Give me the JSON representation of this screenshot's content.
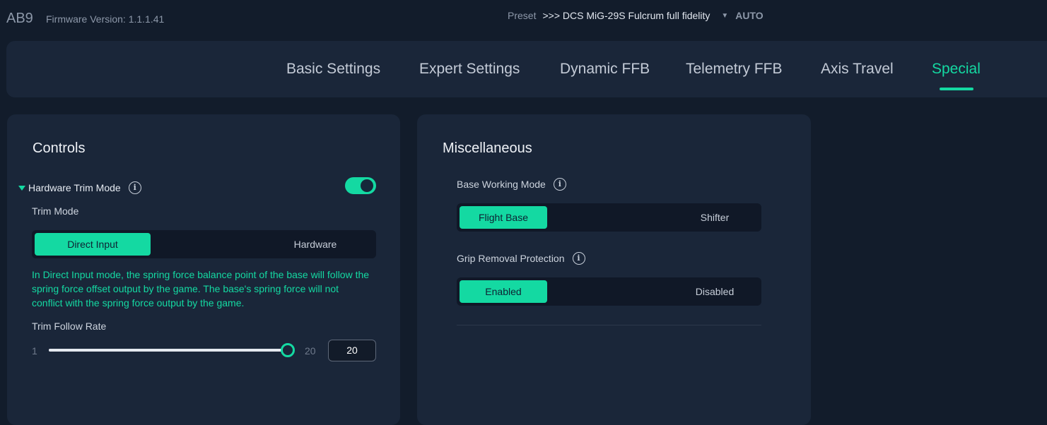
{
  "header": {
    "app_name": "AB9",
    "firmware": "Firmware Version: 1.1.1.41",
    "preset_label": "Preset",
    "preset_value": ">>> DCS MiG-29S Fulcrum  full fidelity",
    "preset_mode": "AUTO"
  },
  "tabs": [
    {
      "label": "Basic Settings"
    },
    {
      "label": "Expert Settings"
    },
    {
      "label": "Dynamic FFB"
    },
    {
      "label": "Telemetry FFB"
    },
    {
      "label": "Axis Travel"
    },
    {
      "label": "Special",
      "active": true
    }
  ],
  "controls": {
    "title": "Controls",
    "hardware_trim_mode": {
      "label": "Hardware Trim Mode",
      "enabled": true
    },
    "trim_mode": {
      "label": "Trim Mode",
      "options": [
        "Direct Input",
        "Hardware"
      ],
      "selected": "Direct Input"
    },
    "description": "In Direct Input mode, the spring force balance point of the base will follow the spring force offset output by the game. The base's spring force will not conflict with the spring force output by the game.",
    "trim_follow_rate": {
      "label": "Trim Follow Rate",
      "min": "1",
      "max": "20",
      "value": "20"
    }
  },
  "misc": {
    "title": "Miscellaneous",
    "base_working_mode": {
      "label": "Base Working Mode",
      "options": [
        "Flight Base",
        "Shifter"
      ],
      "selected": "Flight Base"
    },
    "grip_removal_protection": {
      "label": "Grip Removal Protection",
      "options": [
        "Enabled",
        "Disabled"
      ],
      "selected": "Enabled"
    }
  },
  "colors": {
    "accent": "#14d9a2",
    "background": "#121c2b",
    "panel": "#1a2639"
  }
}
